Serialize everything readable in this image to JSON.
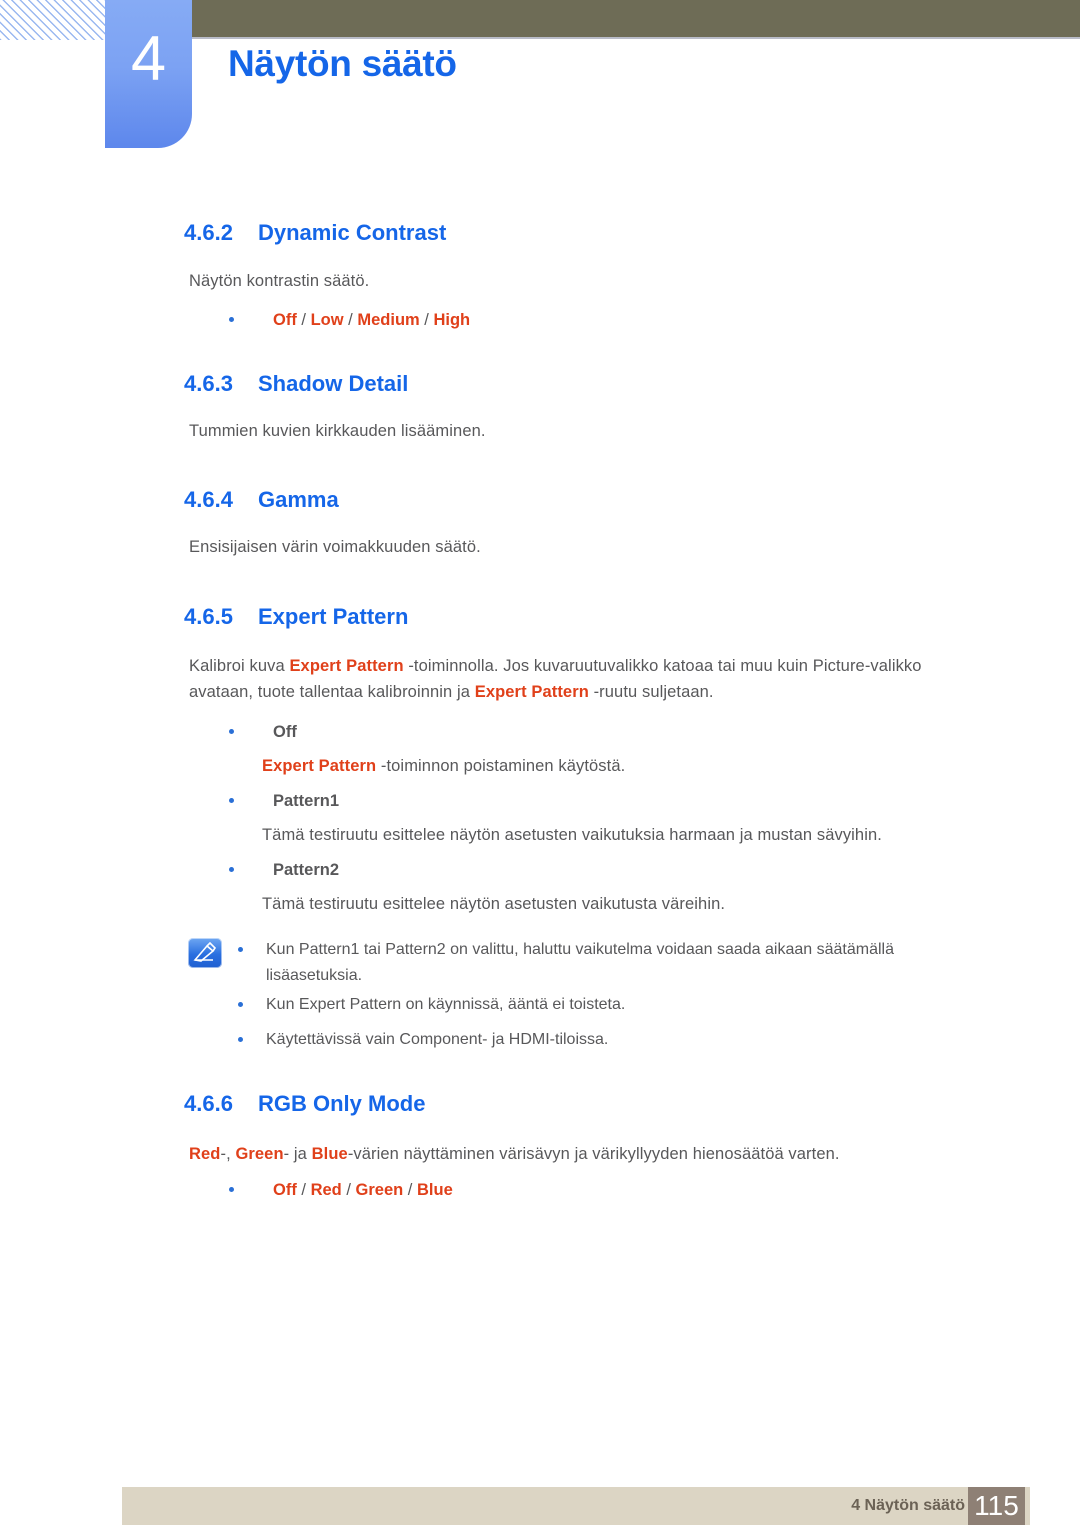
{
  "header": {
    "chapter_number": "4",
    "chapter_title": "Näytön säätö",
    "hatch_icon": "diagonal-hatch-pattern",
    "accent_blue": "#1566e8",
    "olive": "#6e6c56"
  },
  "sections": [
    {
      "number": "4.6.2",
      "title": "Dynamic Contrast",
      "paragraph": "Näytön kontrastin säätö.",
      "options": [
        "Off",
        "Low",
        "Medium",
        "High"
      ]
    },
    {
      "number": "4.6.3",
      "title": "Shadow Detail",
      "paragraph": "Tummien kuvien kirkkauden lisääminen."
    },
    {
      "number": "4.6.4",
      "title": "Gamma",
      "paragraph": "Ensisijaisen värin voimakkuuden säätö."
    },
    {
      "number": "4.6.5",
      "title": "Expert Pattern",
      "intro_line1_a": "Kalibroi kuva ",
      "intro_line1_hl": "Expert Pattern",
      "intro_line1_b": " -toiminnolla. Jos kuvaruutuvalikko katoaa tai muu kuin Picture-valikko",
      "intro_line2_a": "avataan, tuote tallentaa kalibroinnin ja ",
      "intro_line2_hl": "Expert Pattern",
      "intro_line2_b": " -ruutu suljetaan.",
      "items": [
        {
          "label": "Off",
          "desc_hl": "Expert Pattern",
          "desc_rest": " -toiminnon poistaminen käytöstä."
        },
        {
          "label": "Pattern1",
          "desc_rest": "Tämä testiruutu esittelee näytön asetusten vaikutuksia harmaan ja mustan sävyihin."
        },
        {
          "label": "Pattern2",
          "desc_rest": "Tämä testiruutu esittelee näytön asetusten vaikutusta väreihin."
        }
      ]
    },
    {
      "number": "4.6.6",
      "title": "RGB Only Mode",
      "para_red": "Red",
      "para_a": "-, ",
      "para_green": "Green",
      "para_b": "- ja ",
      "para_blue": "Blue",
      "para_c": "-värien näyttäminen värisävyn ja värikyllyyden hienosäätöä varten.",
      "options": [
        "Off",
        "Red",
        "Green",
        "Blue"
      ]
    }
  ],
  "note": {
    "icon": "note-pen-icon",
    "lines": [
      {
        "a": "Kun ",
        "hl1": "Pattern1",
        "b": " tai ",
        "hl2": "Pattern2",
        "c": " on valittu, haluttu vaikutelma voidaan saada aikaan säätämällä lisäasetuksia."
      },
      {
        "a": "Kun ",
        "hl1": "Expert Pattern",
        "c": " on käynnissä, ääntä ei toisteta."
      },
      {
        "a": "Käytettävissä vain Component- ja HDMI-tiloissa."
      }
    ]
  },
  "footer": {
    "label": "4 Näytön säätö",
    "page_number": "115"
  }
}
